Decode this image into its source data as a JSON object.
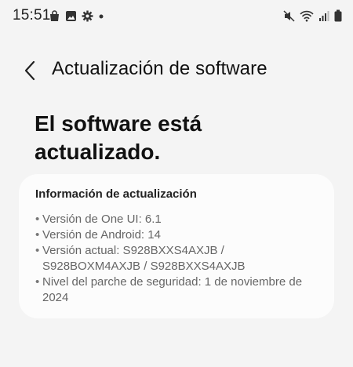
{
  "status_bar": {
    "time": "15:51",
    "left_icons": [
      "shopping-bag-icon",
      "image-icon",
      "settings-gear-icon",
      "notification-dot-icon"
    ],
    "right_icons": [
      "mute-icon",
      "wifi-icon",
      "signal-icon",
      "battery-icon"
    ]
  },
  "app_bar": {
    "title": "Actualización de software"
  },
  "headline": "El software está actualizado.",
  "info_card": {
    "title": "Información de actualización",
    "items": [
      "Versión de One UI: 6.1",
      "Versión de Android: 14",
      "Versión actual: S928BXXS4AXJB / S928BOXM4AXJB / S928BXXS4AXJB",
      "Nivel del parche de seguridad: 1 de noviembre de 2024"
    ]
  }
}
